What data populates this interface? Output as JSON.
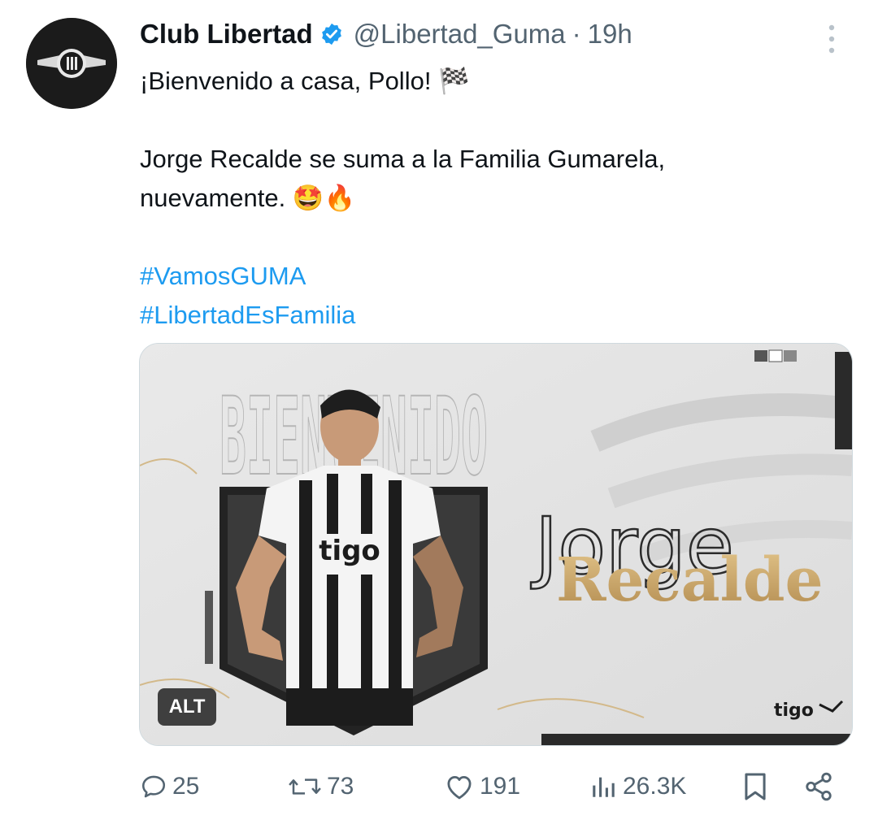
{
  "tweet": {
    "author_name": "Club Libertad",
    "handle": "@Libertad_Guma",
    "separator": "·",
    "time": "19h",
    "lines": [
      "¡Bienvenido a casa, Pollo! 🏁",
      "Jorge Recalde se suma a la Familia Gumarela,",
      "nuevamente. 🤩🔥"
    ],
    "hashtags": [
      "#VamosGUMA",
      "#LibertadEsFamilia"
    ]
  },
  "media": {
    "alt_label": "ALT",
    "graphic_text": {
      "bienvenido": "BIENVENIDO",
      "first_name": "Jorge",
      "last_name": "Recalde",
      "sponsor": "tigo"
    }
  },
  "actions": {
    "replies": "25",
    "reposts": "73",
    "likes": "191",
    "views": "26.3K"
  },
  "icons": {
    "verified": "verified-badge-icon",
    "more": "more-vertical-icon",
    "reply": "reply-icon",
    "repost": "repost-icon",
    "like": "heart-icon",
    "views": "views-icon",
    "bookmark": "bookmark-icon",
    "share": "share-icon"
  },
  "colors": {
    "link": "#1d9bf0",
    "secondary": "#536471",
    "verified": "#1d9bf0"
  }
}
